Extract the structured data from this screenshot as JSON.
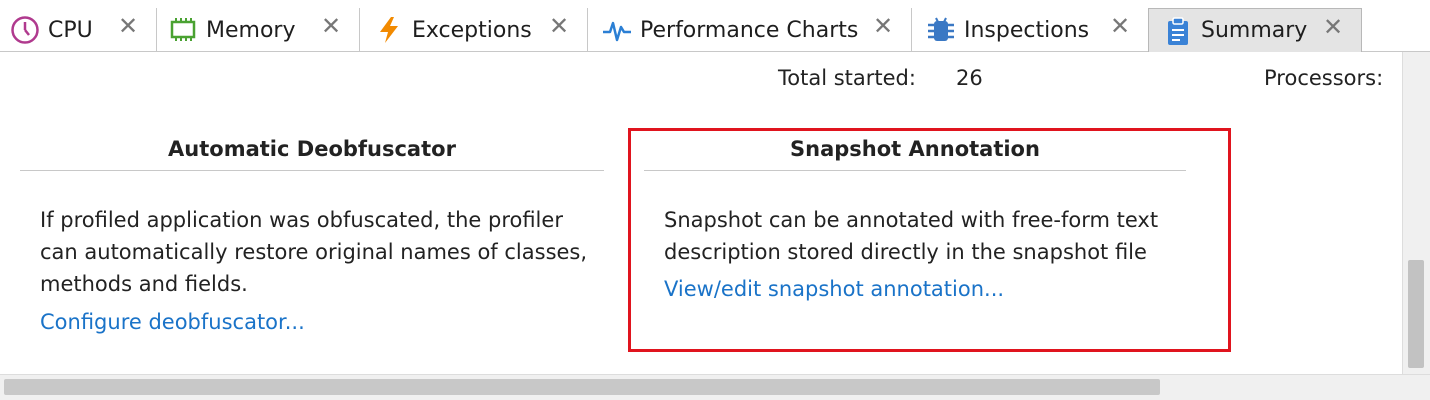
{
  "tabs": [
    {
      "label": "CPU",
      "icon": "clock-icon",
      "active": false
    },
    {
      "label": "Memory",
      "icon": "memory-chip-icon",
      "active": false
    },
    {
      "label": "Exceptions",
      "icon": "lightning-icon",
      "active": false
    },
    {
      "label": "Performance Charts",
      "icon": "pulse-chart-icon",
      "active": false
    },
    {
      "label": "Inspections",
      "icon": "bug-icon",
      "active": false
    },
    {
      "label": "Summary",
      "icon": "clipboard-icon",
      "active": true
    }
  ],
  "tab_close_glyph": "✕",
  "stats": {
    "total_started_label": "Total started:",
    "total_started_value": "26",
    "processors_label": "Processors:"
  },
  "deobfuscator": {
    "title": "Automatic Deobfuscator",
    "lines": [
      "If profiled application was obfuscated, the profiler",
      "can automatically restore original names of classes,",
      "methods and fields."
    ],
    "link": "Configure deobfuscator..."
  },
  "annotation": {
    "title": "Snapshot Annotation",
    "lines": [
      "Snapshot can be annotated with free-form text",
      "description stored directly in the snapshot file"
    ],
    "link": "View/edit snapshot annotation..."
  },
  "colors": {
    "link": "#1a73c8",
    "highlight": "#e0141e",
    "cpu_icon": "#b03a8e",
    "memory_icon": "#4aa232",
    "exceptions_icon": "#f28a00",
    "charts_icon": "#2b7fd4",
    "inspections_icon": "#3a78c4",
    "summary_icon": "#3a82d6"
  }
}
